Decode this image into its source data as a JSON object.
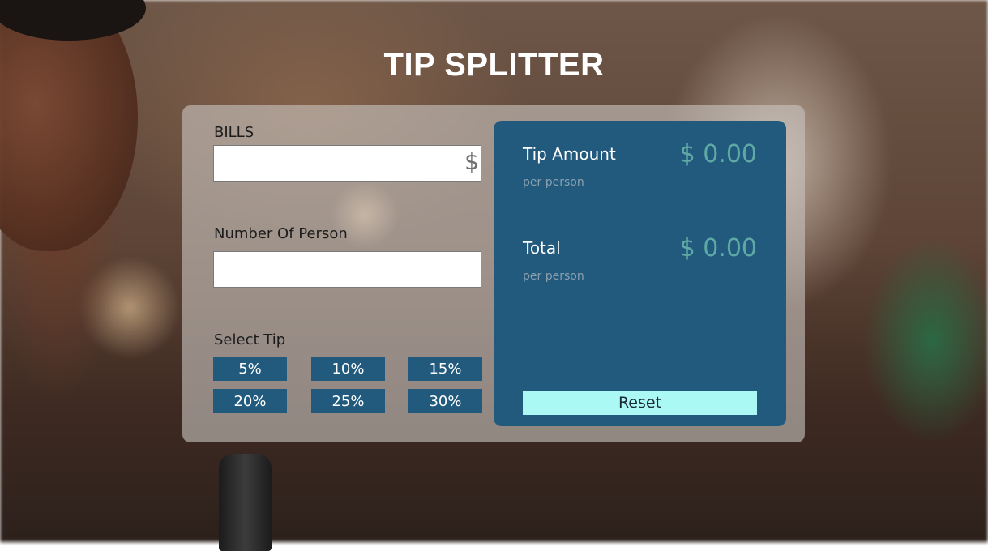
{
  "page": {
    "title": "TIP SPLITTER"
  },
  "form": {
    "bills_label": "BILLS",
    "bills_value": "",
    "bills_placeholder": "",
    "currency_symbol": "$",
    "persons_label": "Number Of Person",
    "persons_value": "",
    "persons_placeholder": "",
    "select_tip_label": "Select Tip",
    "tip_options": [
      "5%",
      "10%",
      "15%",
      "20%",
      "25%",
      "30%"
    ]
  },
  "results": {
    "tip_amount_label": "Tip Amount",
    "tip_amount_sub": "per person",
    "tip_amount_value": "$ 0.00",
    "total_label": "Total",
    "total_sub": "per person",
    "total_value": "$ 0.00",
    "reset_label": "Reset"
  },
  "colors": {
    "panel": "#225a7d",
    "tip_button": "#225a7d",
    "reset_button": "#aaf9f4",
    "result_value": "#5fa9a4"
  }
}
